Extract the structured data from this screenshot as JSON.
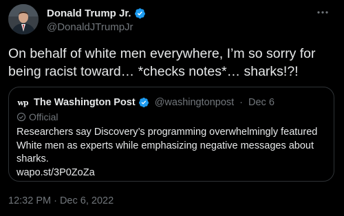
{
  "author": {
    "name": "Donald Trump Jr.",
    "handle": "@DonaldJTrumpJr",
    "verified_icon": "verified-badge-icon"
  },
  "tweet": {
    "text": "On behalf of white men everywhere, I’m so sorry for being racist toward… *checks notes*… sharks!?!",
    "timestamp": "12:32 PM · Dec 6, 2022"
  },
  "quote": {
    "logo_text": "wp",
    "name": "The Washington Post",
    "handle": "@washingtonpost",
    "separator": "·",
    "date": "Dec 6",
    "official_label": "Official",
    "text": "Researchers say Discovery’s programming overwhelmingly featured White men as experts while emphasizing negative messages about sharks.",
    "link": "wapo.st/3P0ZoZa"
  },
  "colors": {
    "background": "#000000",
    "text_primary": "#e7e9ea",
    "text_secondary": "#71767b",
    "verified_blue": "#1d9bf0",
    "border": "#2f3336"
  }
}
